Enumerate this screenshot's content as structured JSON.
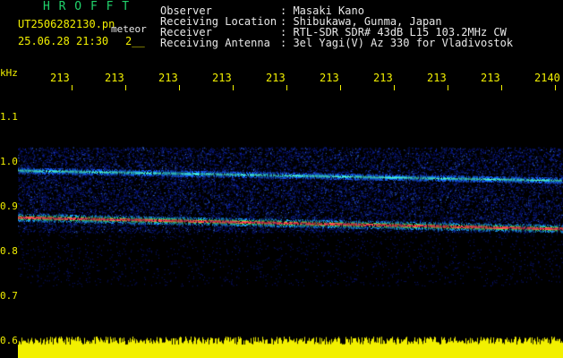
{
  "header": {
    "app_title": "H R O F F T",
    "filename": "UT2506282130.pn",
    "meteor_label": "meteor",
    "date_time": "25.06.28 21:30",
    "count": "2__"
  },
  "info": {
    "observer_label": "Observer",
    "observer_value": ": Masaki Kano",
    "location_label": "Receiving Location",
    "location_value": ": Shibukawa, Gunma, Japan",
    "receiver_label": "Receiver",
    "receiver_value": ": RTL-SDR SDR# 43dB L15 103.2MHz CW",
    "antenna_label": "Receiving Antenna",
    "antenna_value": ": 3el Yagi(V) Az 330 for Vladivostok"
  },
  "axes": {
    "y_unit": "kHz",
    "y_ticks": [
      "1.1",
      "1.0",
      "0.9",
      "0.8",
      "0.7",
      "0.6"
    ],
    "x_ticks": [
      "213",
      "213",
      "213",
      "213",
      "213",
      "213",
      "213",
      "213",
      "213",
      "2140"
    ]
  },
  "colors": {
    "title": "#21d36b",
    "axis": "#f2f000",
    "text": "#e8e8e8",
    "background": "#000000",
    "noise_band": "#f2f000"
  },
  "chart_data": {
    "type": "heatmap",
    "xlabel": "",
    "ylabel": "kHz",
    "ylim": [
      0.6,
      1.12
    ],
    "y_ticks": [
      1.1,
      1.0,
      0.9,
      0.8,
      0.7,
      0.6
    ],
    "x_ticks": [
      "213",
      "213",
      "213",
      "213",
      "213",
      "213",
      "213",
      "213",
      "213",
      "2140"
    ],
    "noise_band_khz": [
      0.82,
      1.0
    ],
    "signal_traces": [
      {
        "start_khz": 0.852,
        "end_khz": 0.828,
        "intensity": "strong"
      },
      {
        "start_khz": 0.951,
        "end_khz": 0.93,
        "intensity": "medium"
      }
    ],
    "grid": false
  }
}
